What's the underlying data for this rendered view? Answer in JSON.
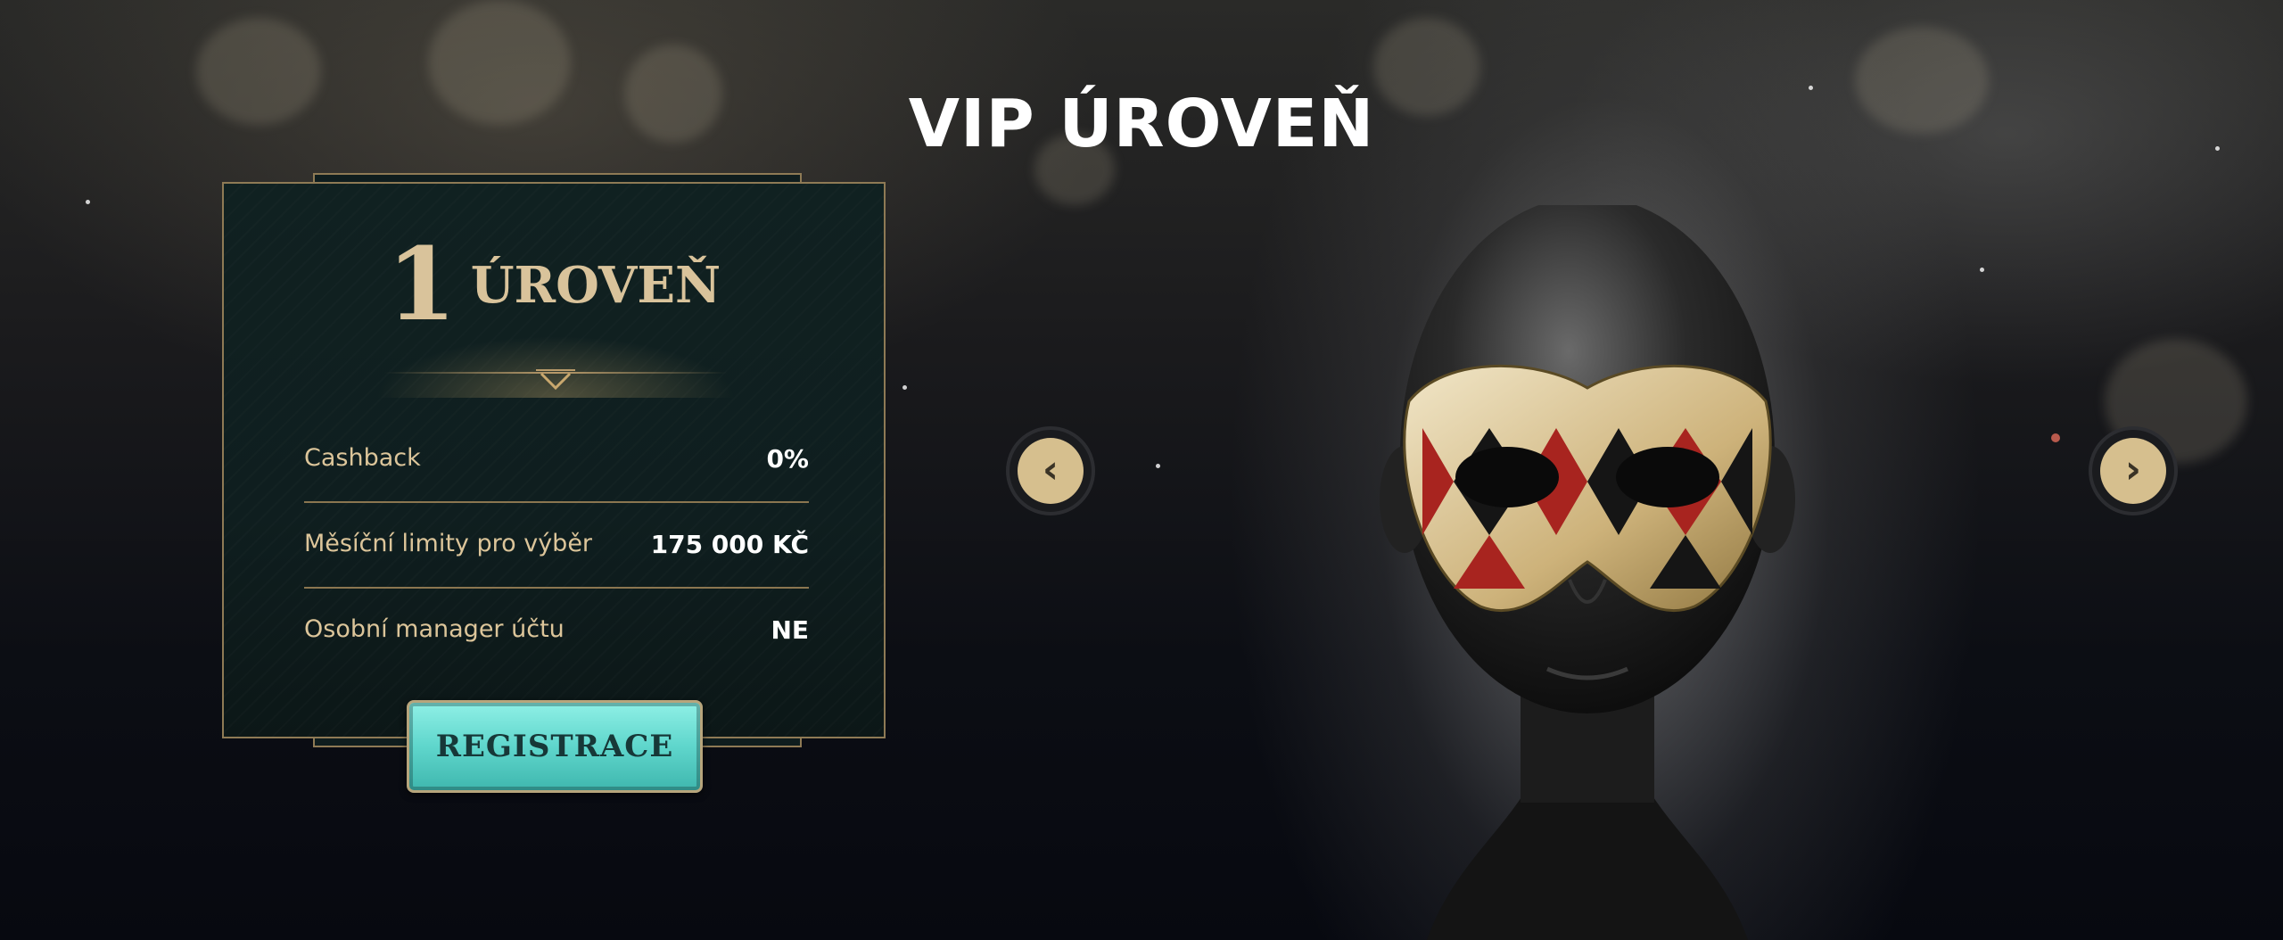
{
  "page": {
    "title": "VIP ÚROVEŇ"
  },
  "level_card": {
    "level_number": "1",
    "level_word": "ÚROVEŇ",
    "rows": [
      {
        "label": "Cashback",
        "value": "0%"
      },
      {
        "label": "Měsíční limity pro výběr",
        "value": "175 000 KČ"
      },
      {
        "label": "Osobní manager účtu",
        "value": "NE"
      }
    ],
    "register_label": "REGISTRACE"
  },
  "navigation": {
    "prev_symbol": "‹",
    "next_symbol": "›"
  },
  "colors": {
    "gold": "#d9c39b",
    "teal_button": "#5fd6cc",
    "card_bg": "#102121",
    "card_border": "#8e7a55"
  },
  "icons": {
    "prev": "chevron-left-icon",
    "next": "chevron-right-icon",
    "decor": "chevron-down-icon"
  }
}
